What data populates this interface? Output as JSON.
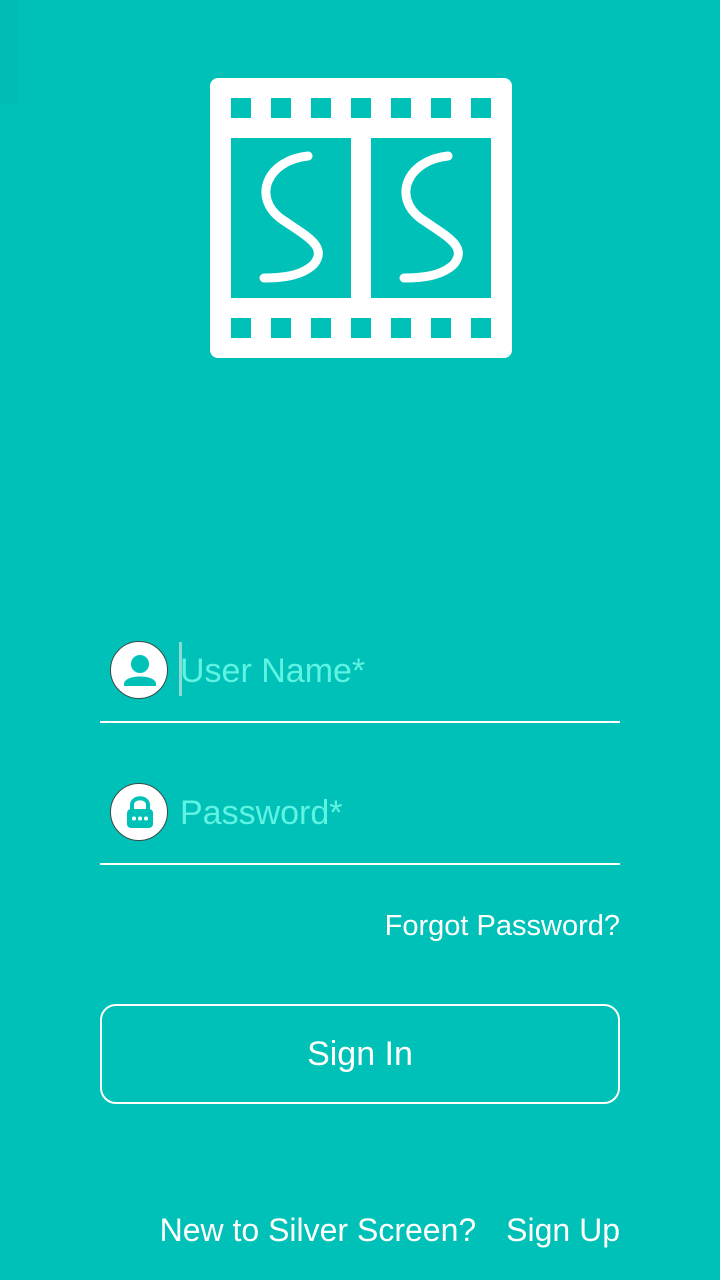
{
  "logo": {
    "letters": "SS",
    "icon": "film-strip-icon"
  },
  "form": {
    "username": {
      "placeholder": "User Name*",
      "value": "",
      "icon": "user-icon"
    },
    "password": {
      "placeholder": "Password*",
      "value": "",
      "icon": "lock-icon"
    },
    "forgot_label": "Forgot Password?",
    "signin_label": "Sign In"
  },
  "footer": {
    "prompt": "New to Silver Screen?",
    "signup_label": "Sign Up"
  },
  "colors": {
    "background": "#00c1b7",
    "accent": "#ffffff",
    "placeholder": "#5ff3e3"
  }
}
